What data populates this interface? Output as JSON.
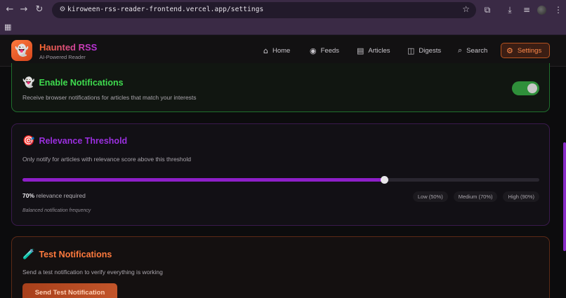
{
  "browser": {
    "url": "kiroween-rss-reader-frontend.vercel.app/settings",
    "icons": {
      "back": "arrow-left-icon",
      "forward": "arrow-right-icon",
      "reload": "reload-icon",
      "site_info": "tune-icon",
      "bookmark": "star-icon",
      "extensions": "puzzle-icon",
      "downloads": "download-icon",
      "media": "queue-music-icon",
      "menu": "kebab-icon",
      "apps": "grid-icon"
    }
  },
  "app": {
    "name": "Haunted RSS",
    "tagline": "AI-Powered Reader",
    "nav": [
      {
        "label": "Home",
        "icon": "home-icon"
      },
      {
        "label": "Feeds",
        "icon": "rss-icon"
      },
      {
        "label": "Articles",
        "icon": "newspaper-icon"
      },
      {
        "label": "Digests",
        "icon": "book-icon"
      },
      {
        "label": "Search",
        "icon": "search-icon"
      },
      {
        "label": "Settings",
        "icon": "gear-icon",
        "active": true
      }
    ],
    "accent_color": "#ff7a3d"
  },
  "notifications": {
    "title": "Enable Notifications",
    "emoji": "ghost",
    "description": "Receive browser notifications for articles that match your interests",
    "enabled": true,
    "color": "#3fdc4f"
  },
  "threshold": {
    "title": "Relevance Threshold",
    "emoji": "target",
    "description": "Only notify for articles with relevance score above this threshold",
    "value": 70,
    "value_label": "70%",
    "suffix": "relevance required",
    "presets": [
      "Low (50%)",
      "Medium (70%)",
      "High (90%)"
    ],
    "hint": "Balanced notification frequency",
    "color": "#9b2fe0"
  },
  "test": {
    "title": "Test Notifications",
    "emoji": "test-tube",
    "description": "Send a test notification to verify everything is working",
    "button_label": "Send Test Notification",
    "color": "#ff7a3d"
  }
}
